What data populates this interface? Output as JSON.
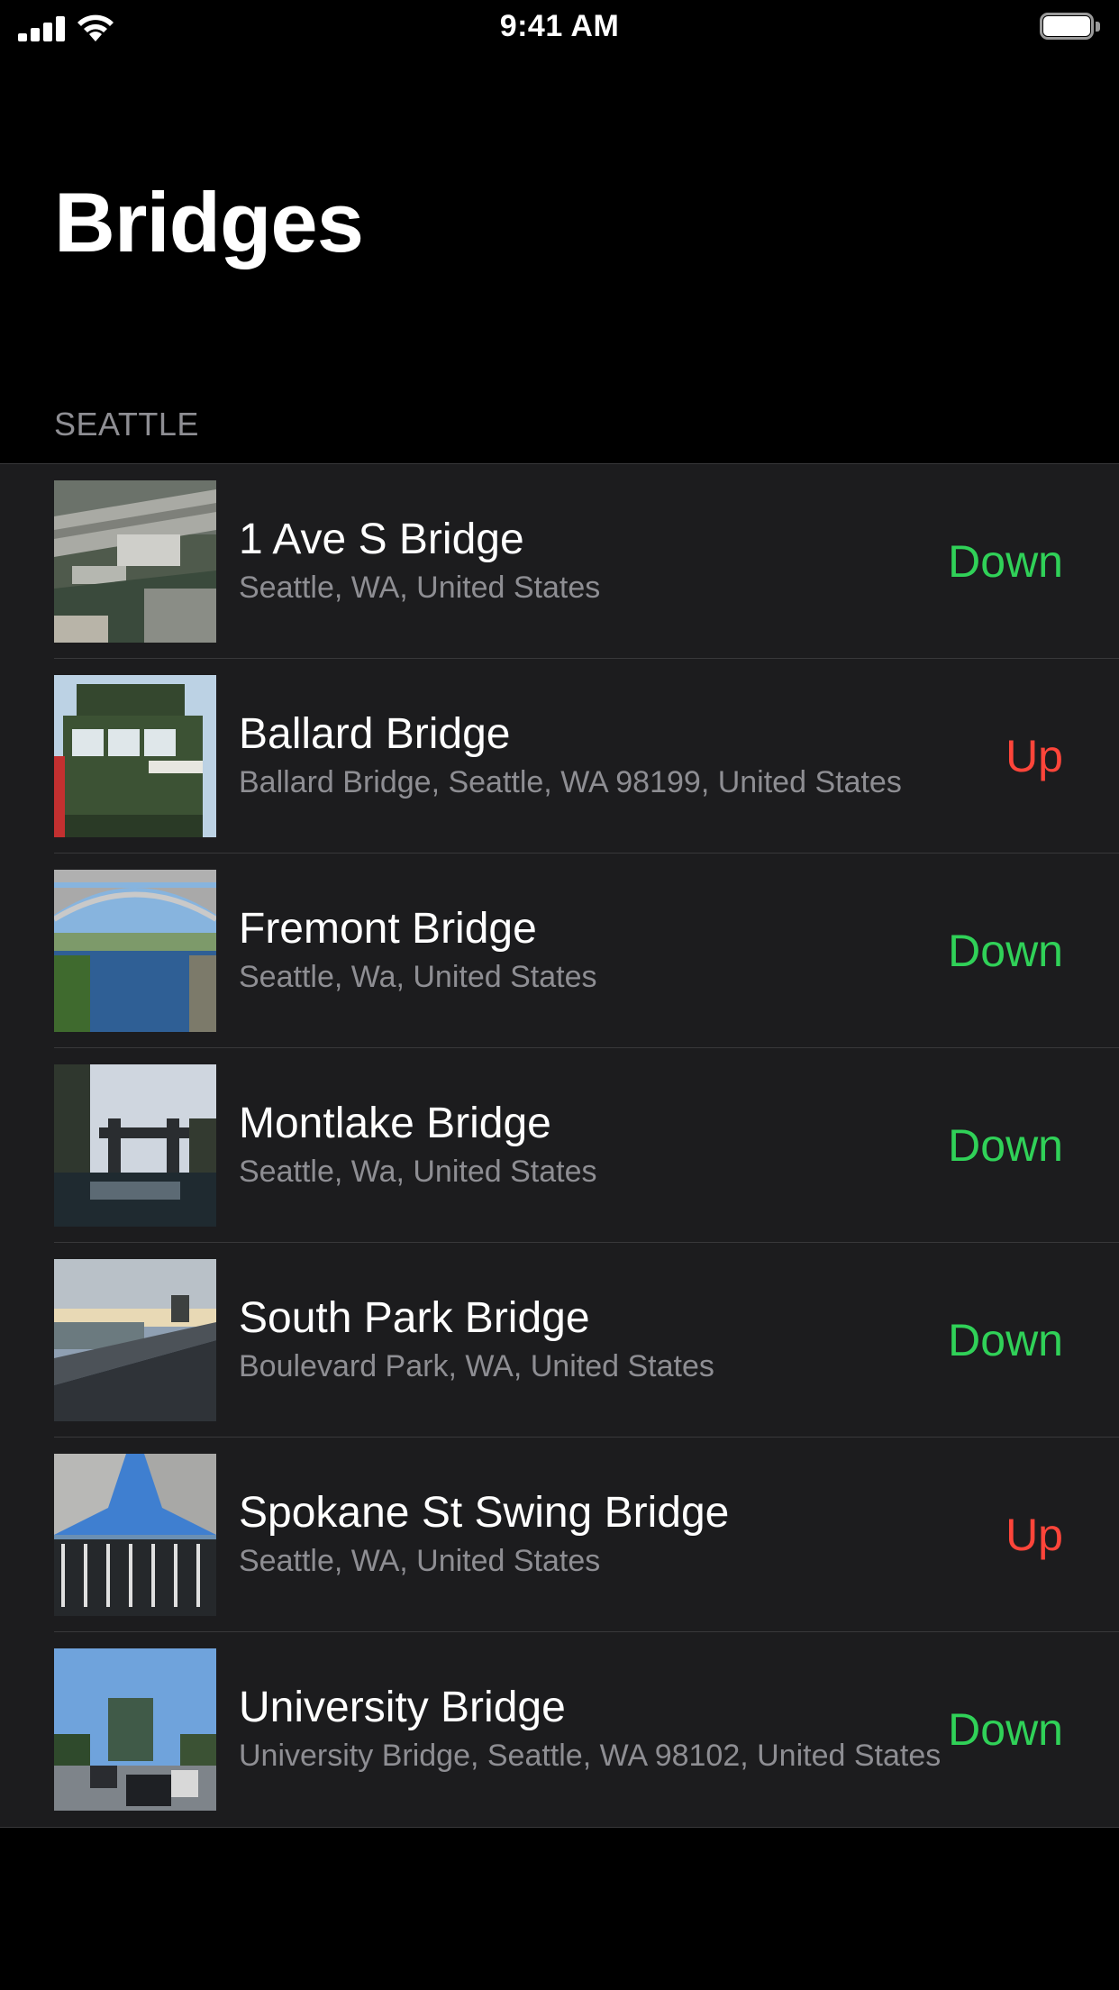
{
  "status_bar": {
    "time": "9:41 AM",
    "signal_icon": "cellular-signal-icon",
    "wifi_icon": "wifi-icon",
    "battery_icon": "battery-icon"
  },
  "title": "Bridges",
  "section": "SEATTLE",
  "colors": {
    "down": "#30d158",
    "up": "#ff453a",
    "background": "#000000",
    "cell": "#1c1c1e",
    "secondary_text": "#8e8e93"
  },
  "bridges": [
    {
      "name": "1 Ave S Bridge",
      "location": "Seattle, WA, United States",
      "status": "Down"
    },
    {
      "name": "Ballard Bridge",
      "location": "Ballard Bridge, Seattle, WA 98199, United States",
      "status": "Up"
    },
    {
      "name": "Fremont Bridge",
      "location": "Seattle, Wa, United States",
      "status": "Down"
    },
    {
      "name": "Montlake Bridge",
      "location": "Seattle, Wa, United States",
      "status": "Down"
    },
    {
      "name": "South Park Bridge",
      "location": "Boulevard Park, WA, United States",
      "status": "Down"
    },
    {
      "name": "Spokane St Swing Bridge",
      "location": "Seattle, WA, United States",
      "status": "Up"
    },
    {
      "name": "University Bridge",
      "location": "University Bridge, Seattle, WA  98102, United States",
      "status": "Down"
    }
  ]
}
